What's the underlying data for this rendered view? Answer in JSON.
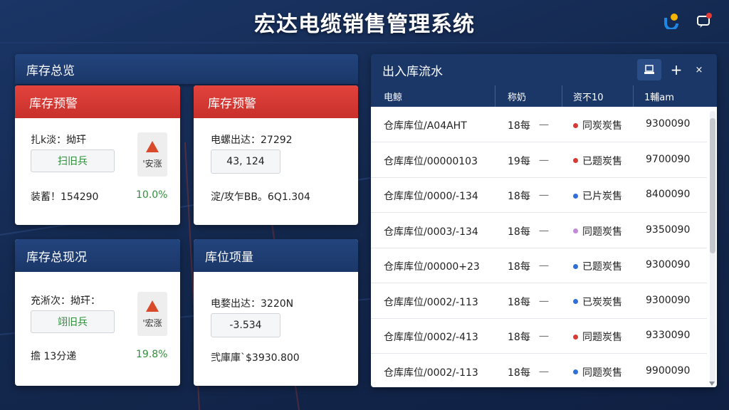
{
  "app": {
    "title": "宏达电缆销售管理系统"
  },
  "header": {
    "icons": [
      "brand-logo-icon",
      "notification-icon"
    ]
  },
  "inventory_overview": {
    "title": "库存总览"
  },
  "cards": {
    "warn1": {
      "title": "库存预警",
      "line1": "扎k淡：拗玕",
      "button": "扫旧兵",
      "badge_text": "'安涨",
      "line3": "装蓄！154290",
      "percent": "10.0%"
    },
    "warn2": {
      "title": "库存预警",
      "line1": "电螺出达：27292",
      "box": "43, 124",
      "line3": "淀/攻乍BB。6Q1.304"
    },
    "status": {
      "title": "库存总现况",
      "line1": "充淅次：拗玕：",
      "button": "翊旧兵",
      "badge_text": "'宏涨",
      "line3": "擔  13分递",
      "percent": "19.8%"
    },
    "volume": {
      "title": "库位项量",
      "line1": "电婺出达：3220N",
      "box": "-3.534",
      "line3": "弐庫庫`$3930.800"
    }
  },
  "flow": {
    "title": "出入库流水",
    "columns": [
      "电鲸",
      "称奶",
      "资不10",
      "1輔am"
    ],
    "rows": [
      {
        "location": "仓库库位/A04AHT",
        "qty": "18每",
        "dash": "一",
        "status": "同炭炭售",
        "status_color": "#d63a34",
        "amount": "9300090"
      },
      {
        "location": "仓库库位/00000103",
        "qty": "19每",
        "dash": "一",
        "status": "已题炭售",
        "status_color": "#d63a34",
        "amount": "9700090"
      },
      {
        "location": "仓库库位/0000/-134",
        "qty": "18每",
        "dash": "一",
        "status": "已片炭售",
        "status_color": "#2f6fd6",
        "amount": "8400090"
      },
      {
        "location": "仓库库位/0003/-134",
        "qty": "18每",
        "dash": "一",
        "status": "同题炭售",
        "status_color": "#c28ad8",
        "amount": "9350090"
      },
      {
        "location": "仓库库位/00000+23",
        "qty": "18每",
        "dash": "一",
        "status": "已题炭售",
        "status_color": "#2f6fd6",
        "amount": "9300090"
      },
      {
        "location": "仓库库位/0002/-113",
        "qty": "18每",
        "dash": "一",
        "status": "已炭炭售",
        "status_color": "#2f6fd6",
        "amount": "9300090"
      },
      {
        "location": "仓库库位/0002/-413",
        "qty": "18每",
        "dash": "一",
        "status": "同题炭售",
        "status_color": "#d63a34",
        "amount": "9330090"
      },
      {
        "location": "仓库库位/0002/-113",
        "qty": "18每",
        "dash": "一",
        "status": "同题炭售",
        "status_color": "#2f6fd6",
        "amount": "9900090"
      }
    ]
  }
}
